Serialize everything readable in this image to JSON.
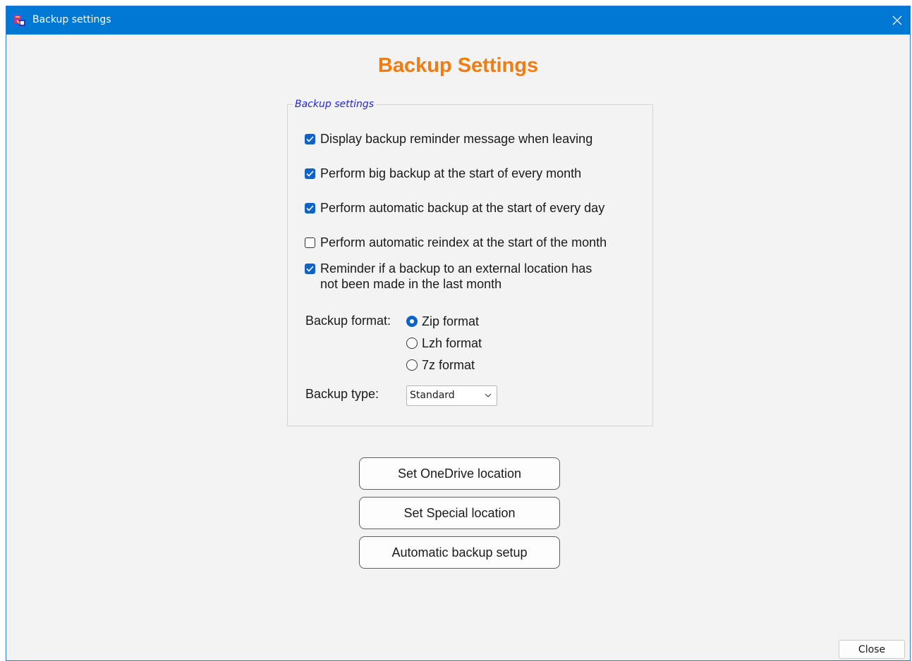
{
  "window": {
    "title": "Backup settings",
    "close_icon": "close-icon"
  },
  "heading": "Backup Settings",
  "group": {
    "legend": "Backup settings",
    "checkboxes": [
      {
        "label": "Display backup reminder message when leaving",
        "checked": true
      },
      {
        "label": "Perform big backup at the start of every month",
        "checked": true
      },
      {
        "label": "Perform automatic backup at the start of every day",
        "checked": true
      },
      {
        "label": "Perform automatic reindex at the start of the month",
        "checked": false
      },
      {
        "label": "Reminder if a backup to an external location has",
        "label2": "not been made in the last month",
        "checked": true
      }
    ],
    "format_label": "Backup format:",
    "formats": [
      {
        "label": "Zip format",
        "selected": true
      },
      {
        "label": "Lzh format",
        "selected": false
      },
      {
        "label": "7z format",
        "selected": false
      }
    ],
    "type_label": "Backup type:",
    "type_value": "Standard"
  },
  "buttons": {
    "onedrive": "Set OneDrive location",
    "special": "Set Special location",
    "automatic": "Automatic backup setup",
    "close": "Close"
  },
  "colors": {
    "titlebar": "#0078d4",
    "heading": "#f07c12",
    "accent": "#0f63c4",
    "legend": "#2525e0"
  }
}
